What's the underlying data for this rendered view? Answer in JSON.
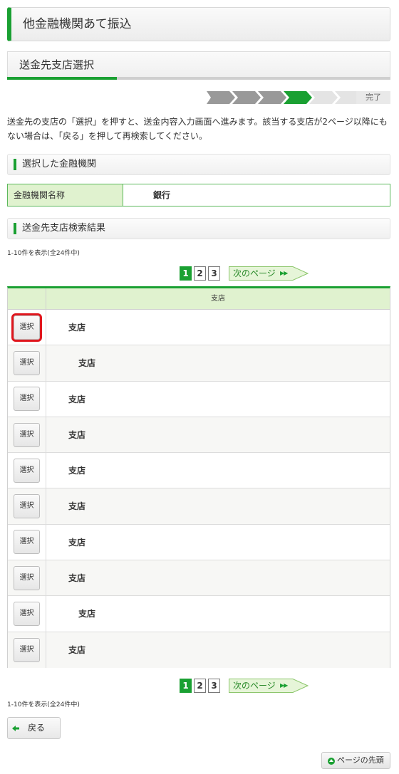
{
  "page_title": "他金融機関あて振込",
  "sub_title": "送金先支店選択",
  "steps": {
    "done_label": "完了",
    "total_steps": 6,
    "current_step": 4
  },
  "instruction": "送金先の支店の「選択」を押すと、送金内容入力画面へ進みます。該当する支店が2ページ以降にもない場合は、「戻る」を押して再検索してください。",
  "selected_bank": {
    "section_title": "選択した金融機関",
    "label": "金融機関名称",
    "value": "銀行"
  },
  "results": {
    "section_title": "送金先支店検索結果",
    "count_text": "1-10件を表示(全24件中)",
    "column_header": "支店",
    "select_label": "選択",
    "rows": [
      {
        "branch": "支店"
      },
      {
        "branch": "支店"
      },
      {
        "branch": "支店"
      },
      {
        "branch": "支店"
      },
      {
        "branch": "支店"
      },
      {
        "branch": "支店"
      },
      {
        "branch": "支店"
      },
      {
        "branch": "支店"
      },
      {
        "branch": "支店"
      },
      {
        "branch": "支店"
      }
    ]
  },
  "pagination": {
    "pages": [
      "1",
      "2",
      "3"
    ],
    "current": "1",
    "next_label": "次のページ",
    "next_arrows": "▶▶"
  },
  "back_label": "戻る",
  "page_top_label": "ページの先頭",
  "colors": {
    "accent_green": "#1aa032",
    "light_green": "#e0f2cf",
    "highlight_red": "#e0161d"
  }
}
